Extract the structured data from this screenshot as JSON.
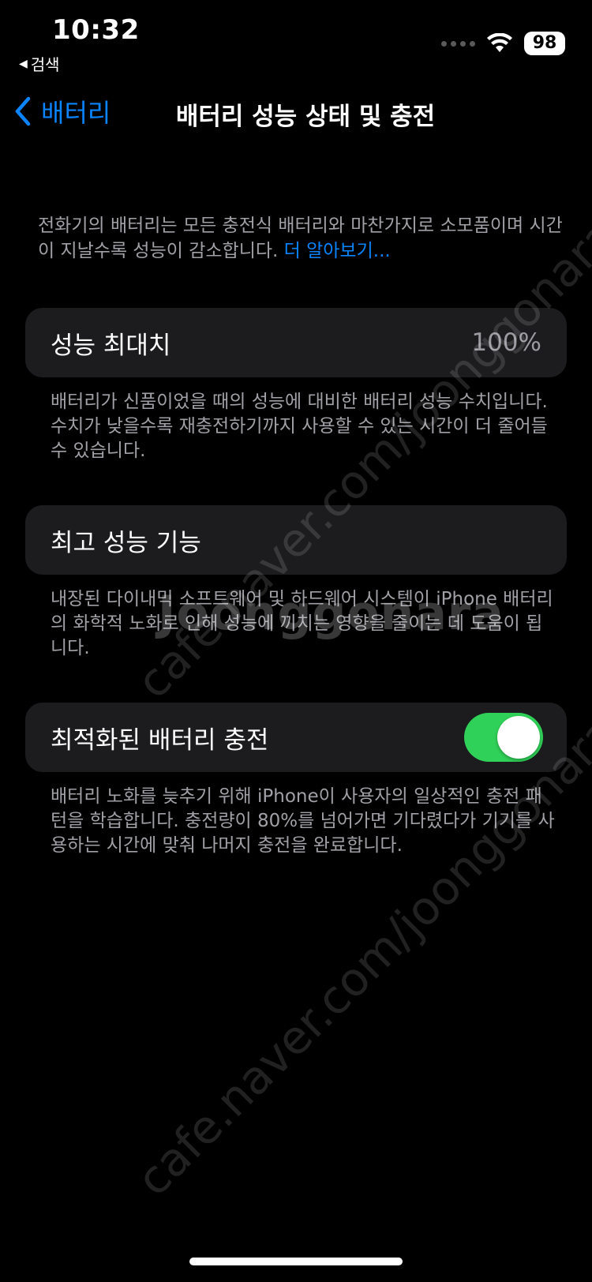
{
  "status_bar": {
    "time": "10:32",
    "back_app": "검색",
    "battery": "98"
  },
  "nav": {
    "back_label": "배터리",
    "title": "배터리 성능 상태 및 충전"
  },
  "intro": {
    "text": "전화기의 배터리는 모든 충전식 배터리와 마찬가지로 소모품이며 시간이 지날수록 성능이 감소합니다.",
    "link": "더 알아보기..."
  },
  "sections": [
    {
      "title": "성능 최대치",
      "value": "100%",
      "footnote": "배터리가 신품이었을 때의 성능에 대비한 배터리 성능 수치입니다. 수치가 낮을수록 재충전하기까지 사용할 수 있는 시간이 더 줄어들 수 있습니다."
    },
    {
      "title": "최고 성능 기능",
      "footnote": "내장된 다이내믹 소프트웨어 및 하드웨어 시스템이 iPhone 배터리의 화학적 노화로 인해 성능에 끼치는 영향을 줄이는 데 도움이 됩니다."
    },
    {
      "title": "최적화된 배터리 충전",
      "toggle_on": true,
      "footnote": "배터리 노화를 늦추기 위해 iPhone이 사용자의 일상적인 충전 패턴을 학습합니다. 충전량이 80%를 넘어가면 기다렸다가 기기를 사용하는 시간에 맞춰 나머지 충전을 완료합니다."
    }
  ],
  "watermark": {
    "url": "cafe.naver.com/joonggonara",
    "brand": "Joonggonara"
  },
  "colors": {
    "accent": "#0a84ff",
    "toggle_on": "#30d158",
    "card": "#1c1c1e",
    "secondary_text": "#a0a0a6"
  }
}
